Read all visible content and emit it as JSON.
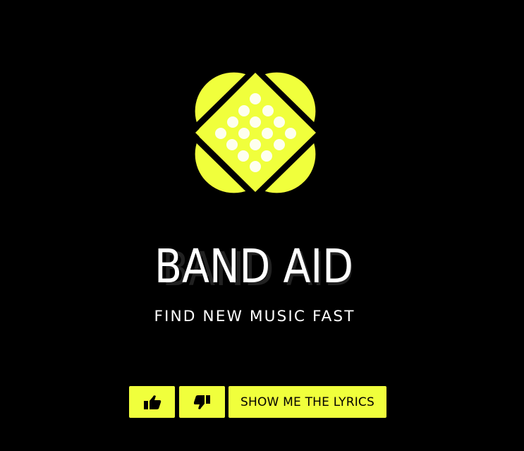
{
  "brand": {
    "name": "BAND AID",
    "tagline": "FIND NEW MUSIC FAST",
    "accent_color": "#f0ff3c",
    "background_color": "#000000",
    "logo_icon": "crossed-bandage-icon"
  },
  "actions": {
    "like_icon": "thumbs-up-icon",
    "dislike_icon": "thumbs-down-icon",
    "lyrics_label": "SHOW ME THE LYRICS"
  }
}
